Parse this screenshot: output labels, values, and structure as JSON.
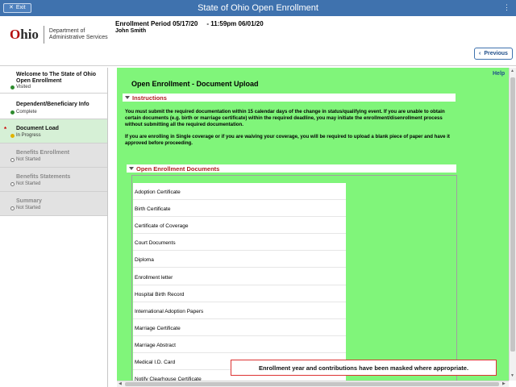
{
  "topbar": {
    "exit_label": "Exit",
    "title": "State of Ohio Open Enrollment",
    "menu_icon": "menu-icon"
  },
  "header": {
    "logo_word": "hio",
    "logo_first": "O",
    "dept_line1": "Department of",
    "dept_line2": "Administrative Services",
    "period": "Enrollment Period 05/17/20     - 11:59pm 06/01/20",
    "user": "John Smith",
    "previous_label": "Previous"
  },
  "sidebar": {
    "steps": [
      {
        "label": "Welcome to The State of Ohio Open Enrollment",
        "status": "Visited",
        "status_color": "#2e8b2e"
      },
      {
        "label": "Dependent/Beneficiary Info",
        "status": "Complete",
        "status_color": "#2e8b2e"
      },
      {
        "label": "Document Load",
        "status": "In Progress",
        "status_color": "#e0b300"
      },
      {
        "label": "Benefits Enrollment",
        "status": "Not Started"
      },
      {
        "label": "Benefits Statements",
        "status": "Not Started"
      },
      {
        "label": "Summary",
        "status": "Not Started"
      }
    ]
  },
  "main": {
    "help": "Help",
    "title": "Open Enrollment - Document Upload",
    "instructions_header": "Instructions",
    "instructions_p1": "You must submit the required documentation within 15 calendar days of the change in status/qualifying event. If you are unable to obtain certain documents (e.g. birth or marriage certificate) within the required deadline, you may initiate the enrollment/disenrollment process without submitting all the required documentation.",
    "instructions_p2": "If you are enrolling in Single coverage or if you are waiving your coverage, you will be required to upload a blank piece of paper and have it approved before proceeding.",
    "documents_header": "Open Enrollment Documents",
    "documents": [
      "Adoption Certificate",
      "Birth Certificate",
      "Certificate of Coverage",
      "Court Documents",
      "Diploma",
      "Enrollment letter",
      "Hospital Birth Record",
      "International Adoption Papers",
      "Marriage Certificate",
      "Marriage Abstract",
      "Medical I.D. Card",
      "Notify Clearhouse Certificate"
    ]
  },
  "notice": "Enrollment year and contributions have been masked where appropriate.",
  "colors": {
    "topbar": "#3f72ae",
    "main_bg": "#80f57a",
    "section_header_text": "#b02020"
  }
}
